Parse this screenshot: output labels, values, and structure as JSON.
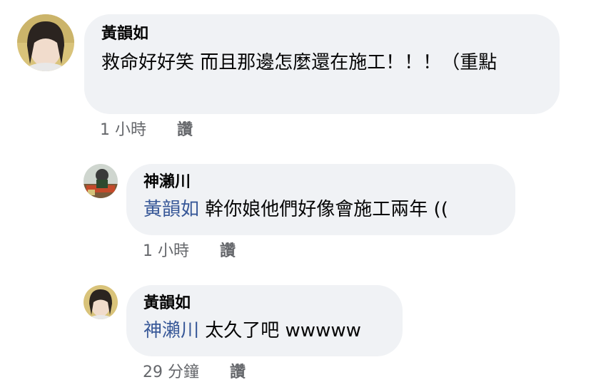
{
  "comments": [
    {
      "author": "黃韻如",
      "text": "救命好好笑 而且那邊怎麼還在施工！！！（重點",
      "time": "1 小時",
      "like_label": "讚"
    },
    {
      "author": "神瀨川",
      "mention": "黃韻如",
      "text": "幹你娘他們好像會施工兩年 ((",
      "time": "1 小時",
      "like_label": "讚"
    },
    {
      "author": "黃韻如",
      "mention": "神瀨川",
      "text": "太久了吧 wwwww",
      "time": "29 分鐘",
      "like_label": "讚"
    }
  ],
  "colors": {
    "bubble": "#f0f2f5",
    "mention": "#385898",
    "meta": "#65676b"
  }
}
